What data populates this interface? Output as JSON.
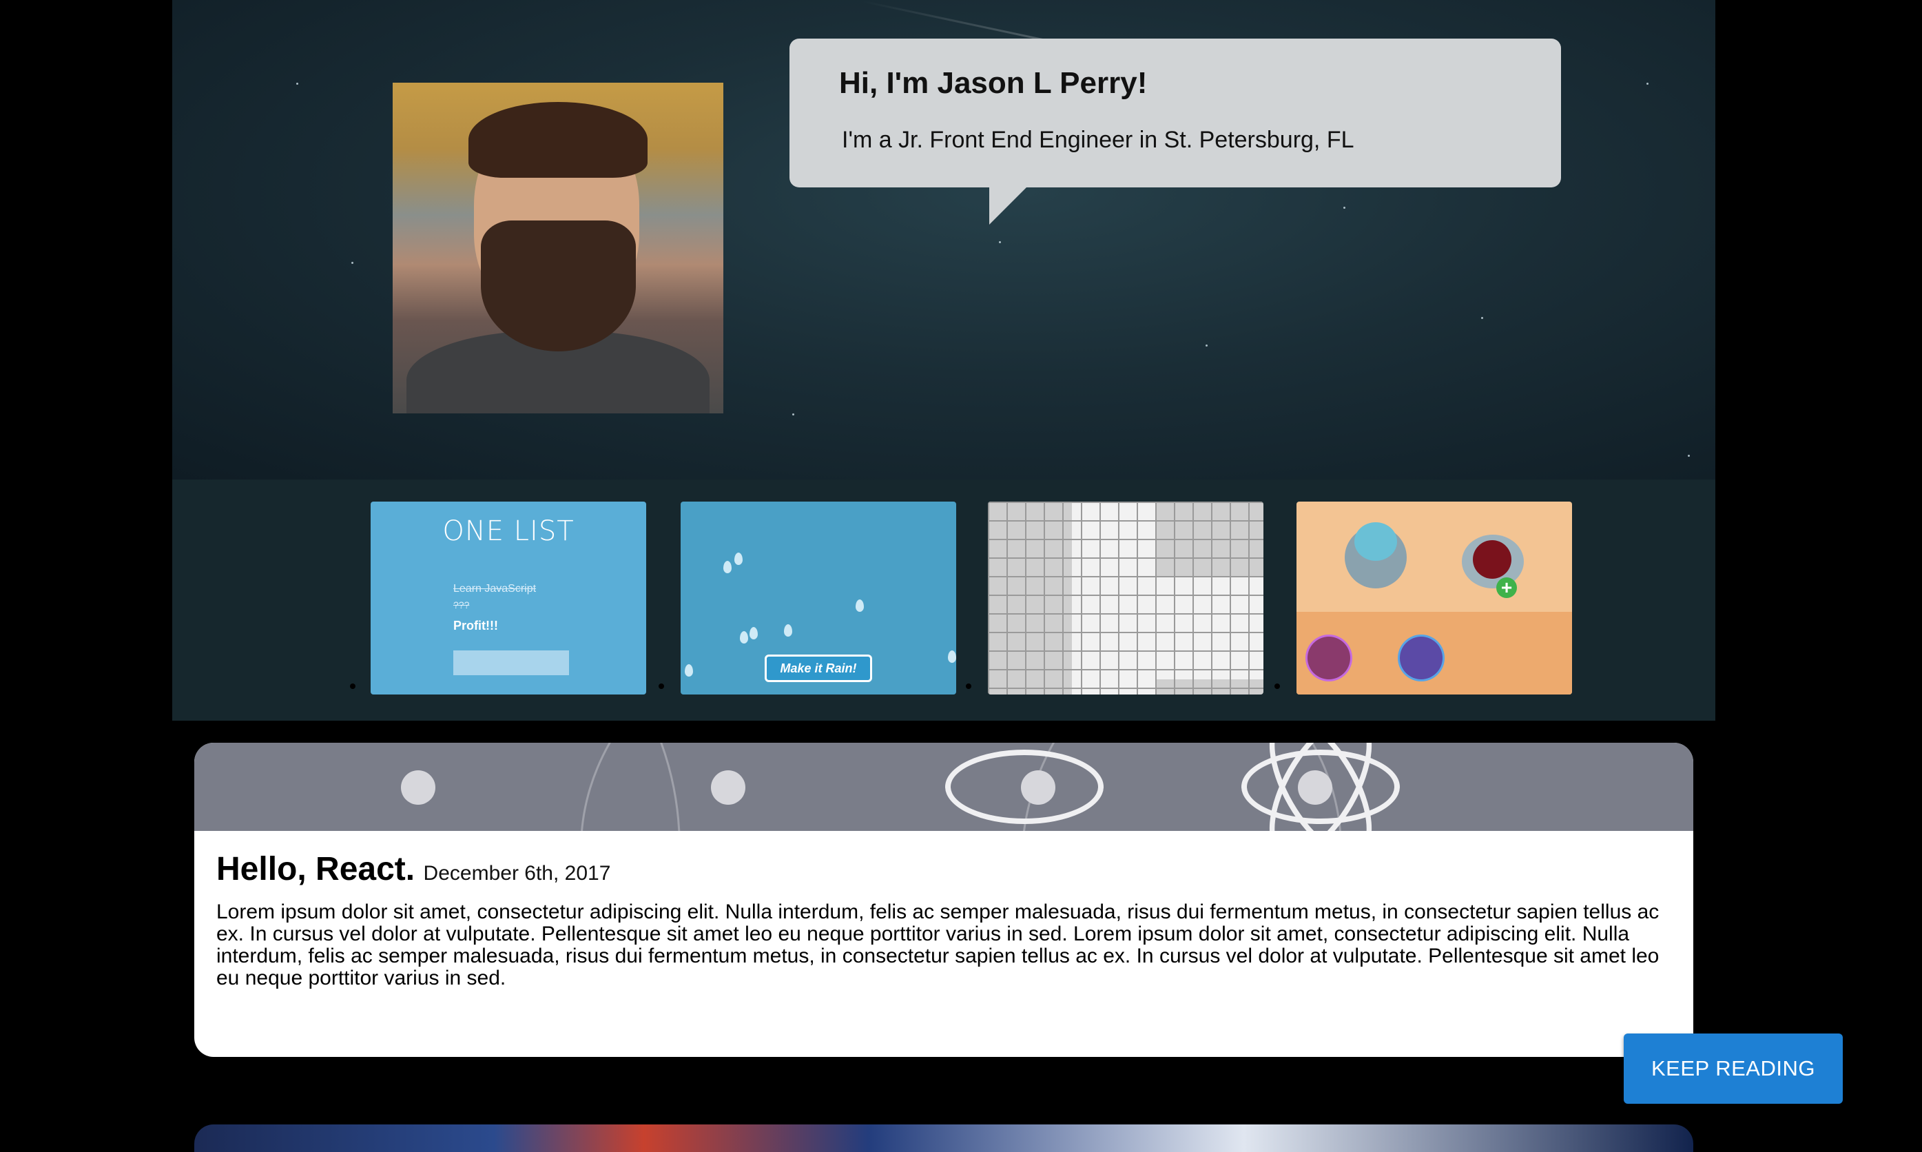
{
  "hero": {
    "greeting": "Hi, I'm Jason L Perry!",
    "subtitle": "I'm a Jr. Front End Engineer in St. Petersburg, FL",
    "avatar_alt": "Portrait photo"
  },
  "carousel": {
    "slides": [
      {
        "name": "one-list",
        "title": "ONE LIST",
        "items": [
          "Learn JavaScript",
          "???",
          "Profit!!!"
        ]
      },
      {
        "name": "make-it-rain",
        "button": "Make it Rain!"
      },
      {
        "name": "minesweeper"
      },
      {
        "name": "bowls-game"
      }
    ]
  },
  "post": {
    "title": "Hello, React.",
    "date": "December 6th, 2017",
    "body": "Lorem ipsum dolor sit amet, consectetur adipiscing elit. Nulla interdum, felis ac semper malesuada, risus dui fermentum metus, in consectetur sapien tellus ac ex. In cursus vel dolor at vulputate. Pellentesque sit amet leo eu neque porttitor varius in sed. Lorem ipsum dolor sit amet, consectetur adipiscing elit. Nulla interdum, felis ac semper malesuada, risus dui fermentum metus, in consectetur sapien tellus ac ex. In cursus vel dolor at vulputate. Pellentesque sit amet leo eu neque porttitor varius in sed.",
    "button": "KEEP READING"
  },
  "colors": {
    "accent": "#1e80d4",
    "bubble": "#d1d4d6",
    "background": "#000000"
  }
}
